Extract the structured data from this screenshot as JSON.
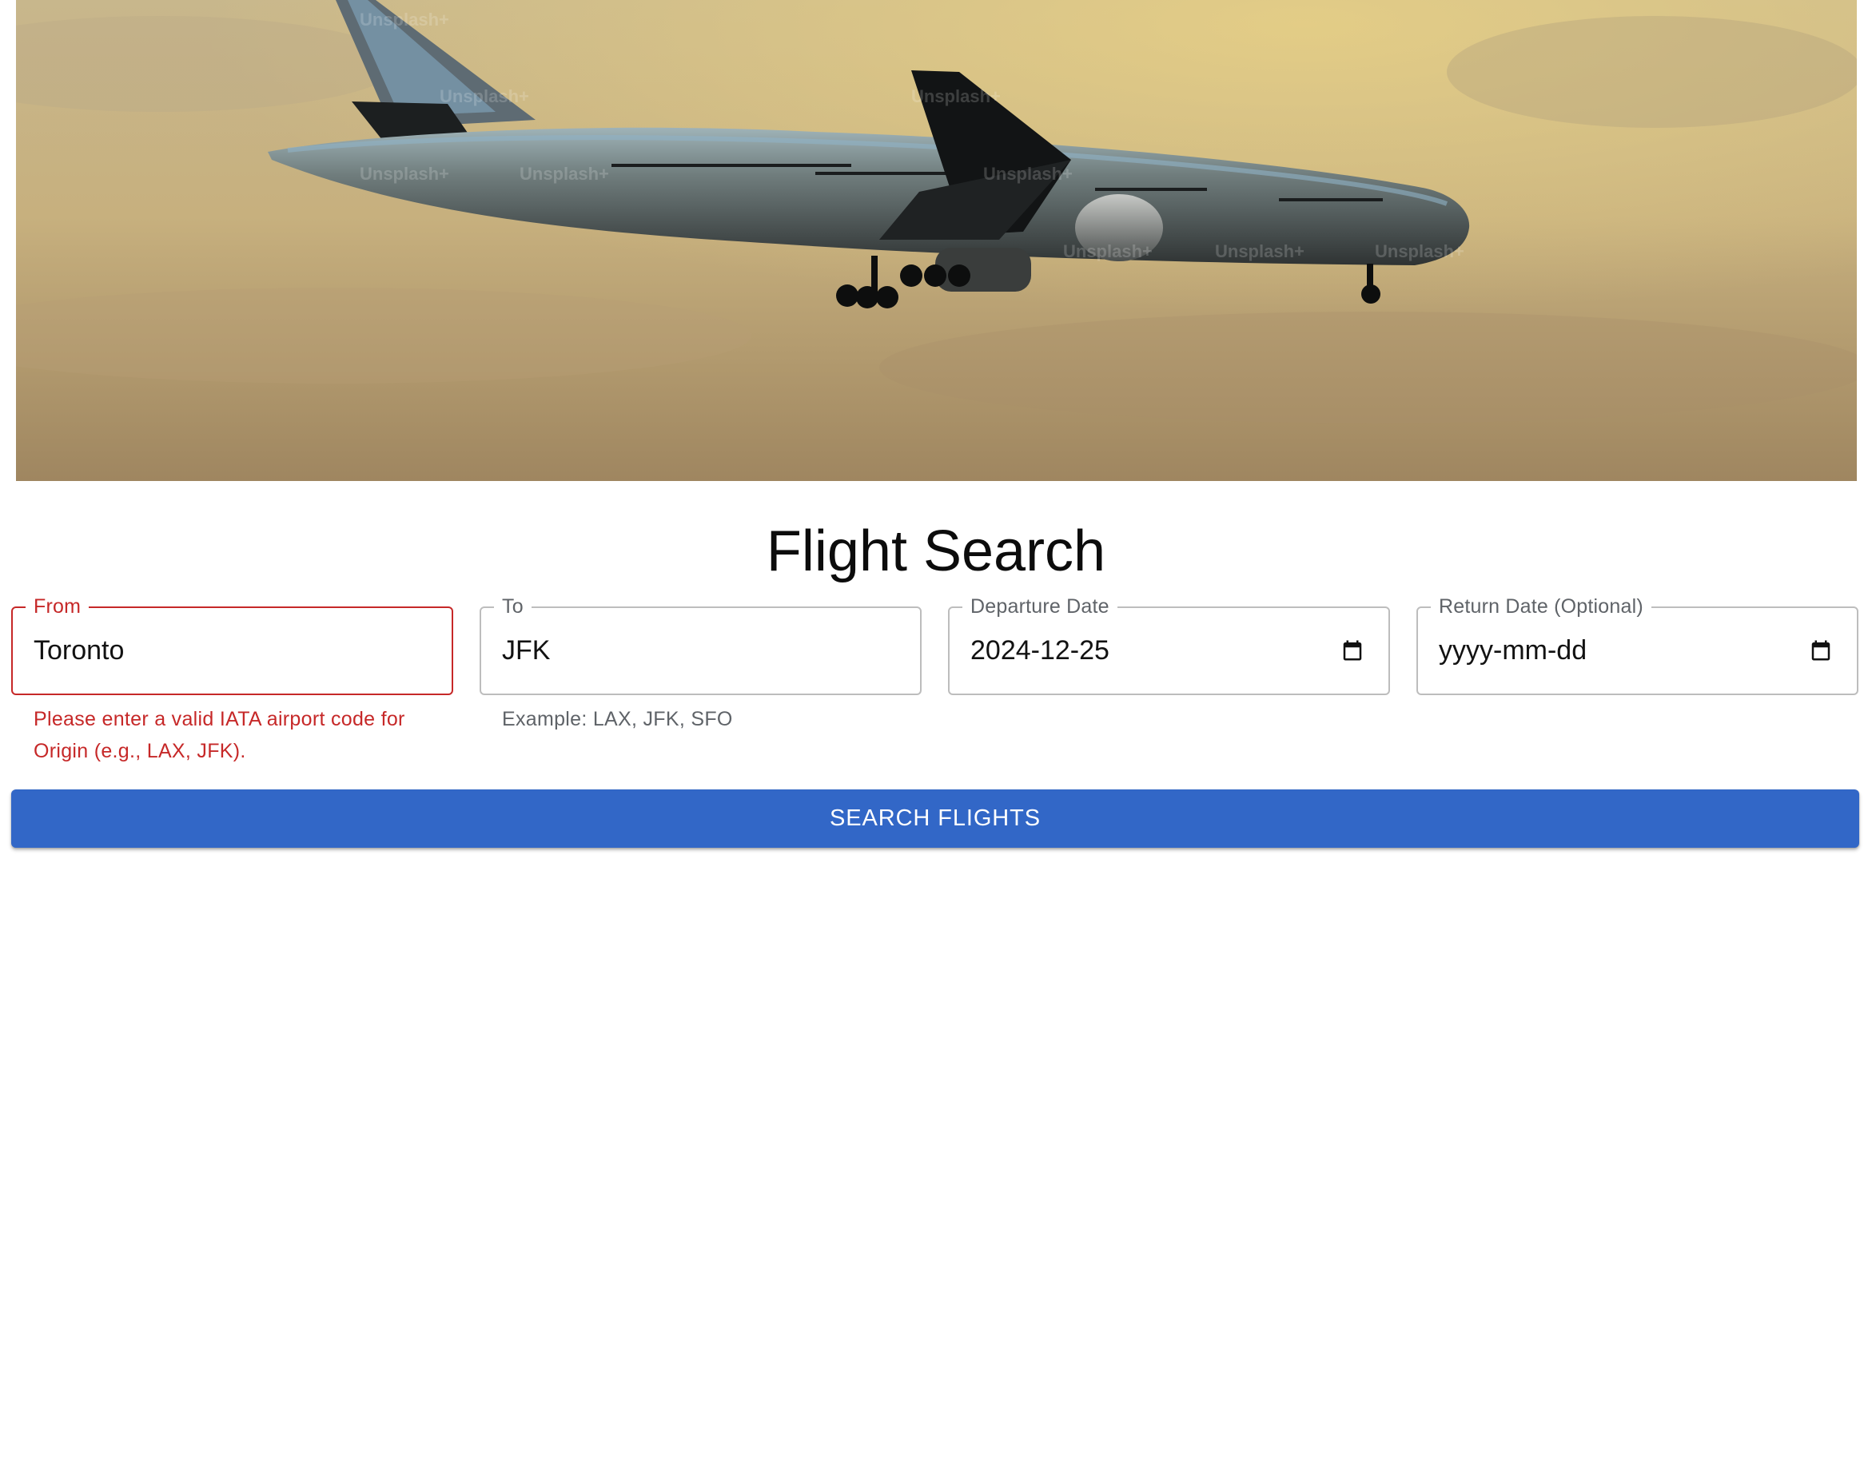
{
  "hero": {
    "watermark": "Unsplash+"
  },
  "page_title": "Flight Search",
  "form": {
    "from": {
      "label": "From",
      "value": "Toronto",
      "error": "Please enter a valid IATA airport code for Origin (e.g., LAX, JFK)."
    },
    "to": {
      "label": "To",
      "value": "JFK",
      "helper": "Example: LAX, JFK, SFO"
    },
    "departure_date": {
      "label": "Departure Date",
      "value": "2024-12-25",
      "icon": "calendar-icon"
    },
    "return_date": {
      "label": "Return Date (Optional)",
      "placeholder": "yyyy-mm-dd",
      "icon": "calendar-icon"
    },
    "search_button_label": "SEARCH FLIGHTS"
  },
  "colors": {
    "primary": "#3267c7",
    "error": "#c62828",
    "border": "#bdbdbd",
    "helper_text": "#5f6368"
  }
}
